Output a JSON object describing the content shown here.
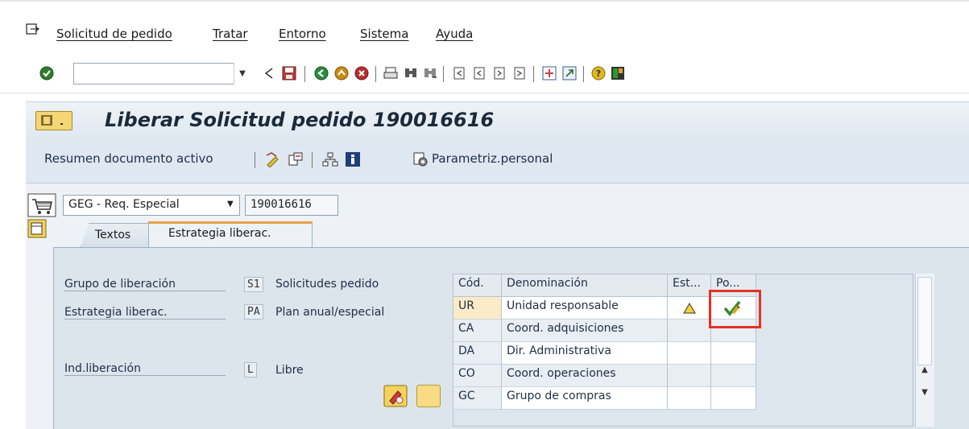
{
  "menu": {
    "items": [
      {
        "label": "Solicitud de pedido"
      },
      {
        "label": "Tratar"
      },
      {
        "label": "Entorno"
      },
      {
        "label": "Sistema"
      },
      {
        "label": "Ayuda"
      }
    ]
  },
  "toolbar": {
    "command_value": "",
    "icons": [
      "enter-check-icon",
      "back-icon",
      "save-icon",
      "exit-icon",
      "cancel-icon",
      "print-icon",
      "find-icon",
      "find-next-icon",
      "first-page-icon",
      "prev-page-icon",
      "next-page-icon",
      "last-page-icon",
      "new-session-icon",
      "shortcut-icon",
      "help-icon",
      "layout-icon"
    ]
  },
  "title": {
    "text": "Liberar Solicitud pedido 190016616"
  },
  "app_toolbar": {
    "resumen_label": "Resumen documento activo",
    "parametriz_label": "Parametriz.personal"
  },
  "document": {
    "type": "GEG - Req. Especial",
    "number": "190016616"
  },
  "tabs": [
    {
      "label": "Textos"
    },
    {
      "label": "Estrategia liberac."
    }
  ],
  "release": {
    "grupo_label": "Grupo de liberación",
    "grupo_code": "S1",
    "grupo_value": "Solicitudes pedido",
    "estrategia_label": "Estrategia liberac.",
    "estrategia_code": "PA",
    "estrategia_value": "Plan anual/especial",
    "ind_label": "Ind.liberación",
    "ind_code": "L",
    "ind_value": "Libre"
  },
  "table": {
    "headers": [
      "Cód.",
      "Denominación",
      "Est...",
      "Po..."
    ],
    "rows": [
      {
        "code": "UR",
        "name": "Unidad responsable",
        "status": "warning",
        "action": "release"
      },
      {
        "code": "CA",
        "name": "Coord. adquisiciones",
        "status": "",
        "action": ""
      },
      {
        "code": "DA",
        "name": "Dir. Administrativa",
        "status": "",
        "action": ""
      },
      {
        "code": "CO",
        "name": "Coord. operaciones",
        "status": "",
        "action": ""
      },
      {
        "code": "GC",
        "name": "Grupo de compras",
        "status": "",
        "action": ""
      }
    ]
  },
  "colors": {
    "accent_orange": "#e8a04c",
    "highlight_red": "#e53122"
  }
}
